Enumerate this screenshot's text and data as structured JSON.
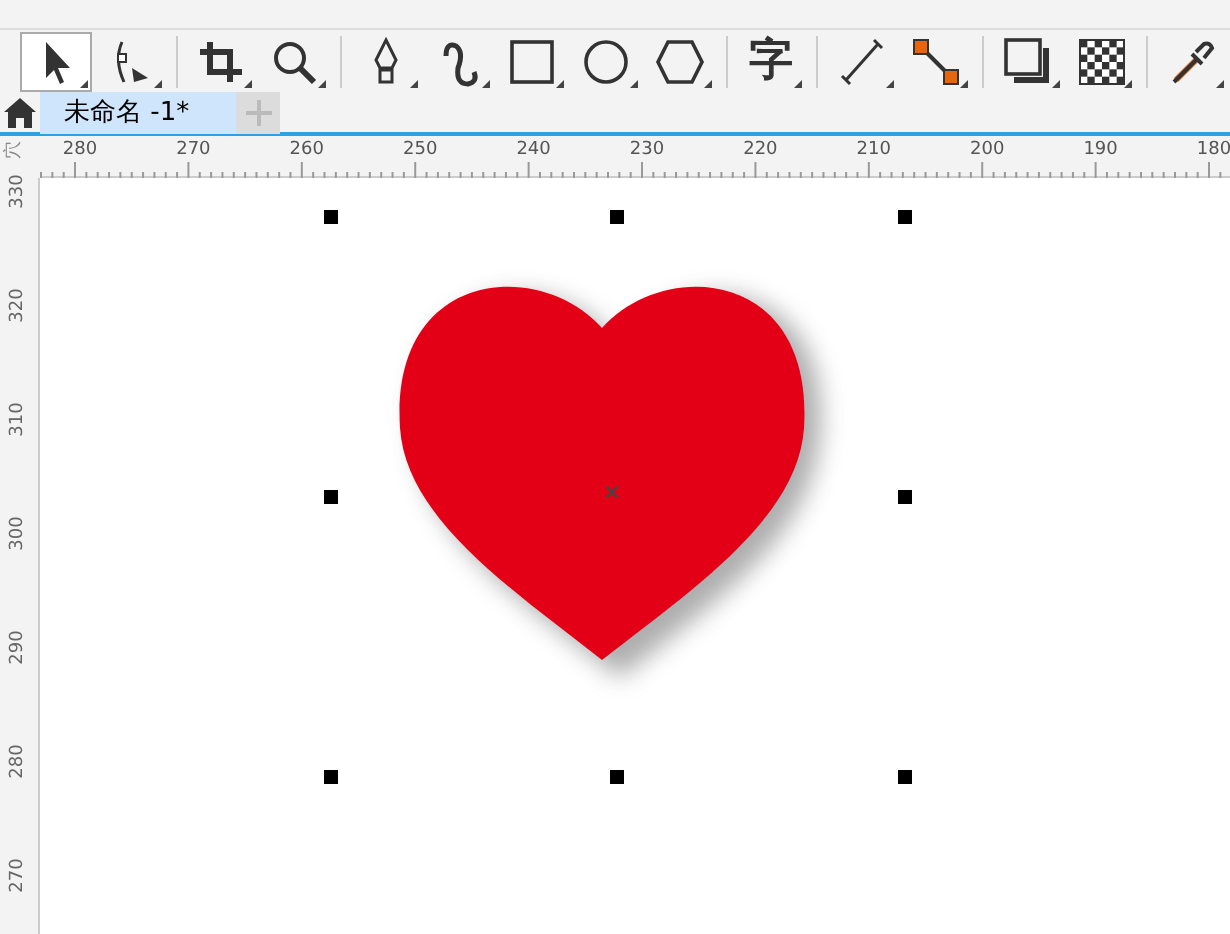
{
  "toolbar": [
    {
      "kind": "pick",
      "selected": true
    },
    {
      "kind": "shape",
      "selected": false
    },
    {
      "kind": "crop",
      "selected": false
    },
    {
      "kind": "zoom",
      "selected": false
    },
    {
      "kind": "pen",
      "selected": false
    },
    {
      "kind": "curve",
      "selected": false
    },
    {
      "kind": "rect",
      "selected": false
    },
    {
      "kind": "ellipse",
      "selected": false
    },
    {
      "kind": "polygon",
      "selected": false
    },
    {
      "kind": "text",
      "label": "字",
      "selected": false
    },
    {
      "kind": "dimension",
      "selected": false
    },
    {
      "kind": "connector",
      "selected": false
    },
    {
      "kind": "shadow",
      "selected": false
    },
    {
      "kind": "transparency",
      "selected": false
    },
    {
      "kind": "eyedropper",
      "selected": false
    }
  ],
  "document_tabs": [
    {
      "label": "未命名 -1*",
      "selected": true
    }
  ],
  "ruler_horizontal": [
    "280",
    "270",
    "260",
    "250",
    "240",
    "230",
    "220",
    "210",
    "200",
    "190",
    "180"
  ],
  "ruler_vertical": [
    "330",
    "320",
    "310",
    "300",
    "290",
    "280",
    "270"
  ],
  "ruler_corner": "穴",
  "heart": {
    "color": "#e30016",
    "selected": true
  }
}
